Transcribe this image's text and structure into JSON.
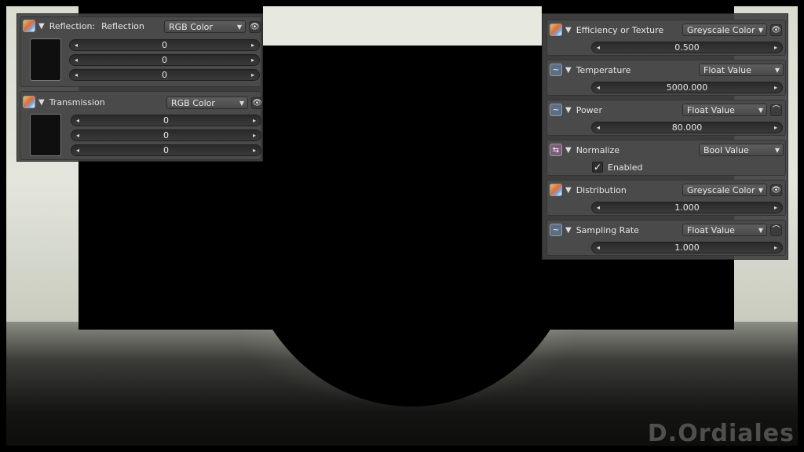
{
  "watermark": "D.Ordiales",
  "left_panel": {
    "reflection": {
      "label": "Reflection:",
      "value_name": "Reflection",
      "type": "RGB Color",
      "values": [
        "0",
        "0",
        "0"
      ]
    },
    "transmission": {
      "label": "Transmission",
      "type": "RGB Color",
      "values": [
        "0",
        "0",
        "0"
      ]
    }
  },
  "right_panel": {
    "efficiency": {
      "label": "Efficiency or Texture",
      "type": "Greyscale Color",
      "value": "0.500",
      "fill": 0.5
    },
    "temperature": {
      "label": "Temperature",
      "type": "Float Value",
      "value": "5000.000"
    },
    "power": {
      "label": "Power",
      "type": "Float Value",
      "value": "80.000"
    },
    "normalize": {
      "label": "Normalize",
      "type": "Bool Value",
      "check_label": "Enabled",
      "checked": true
    },
    "distribution": {
      "label": "Distribution",
      "type": "Greyscale Color",
      "value": "1.000",
      "fill": 1.0
    },
    "sampling_rate": {
      "label": "Sampling Rate",
      "type": "Float Value",
      "value": "1.000"
    }
  },
  "icons": {
    "check": "✓",
    "eye": "👁",
    "curve": "⌒",
    "left_arrow": "◂",
    "right_arrow": "▸",
    "collapse": "▼",
    "dropdown": "▼"
  }
}
